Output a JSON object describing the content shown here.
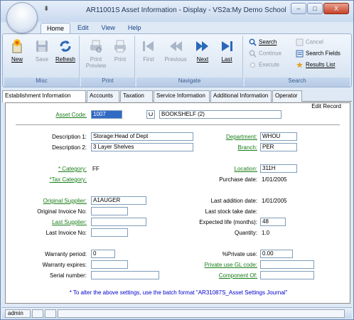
{
  "window": {
    "title": "AR11001S Asset Information - Display - VS2a:My Demo School",
    "qat_symbol": "⇟",
    "minimize": "–",
    "maximize": "□",
    "close": "X"
  },
  "ribbon_tabs": [
    {
      "label": "Home",
      "active": true
    },
    {
      "label": "Edit",
      "active": false
    },
    {
      "label": "View",
      "active": false
    },
    {
      "label": "Help",
      "active": false
    }
  ],
  "ribbon": {
    "misc": {
      "caption": "Misc",
      "new": "New",
      "save": "Save",
      "refresh": "Refresh"
    },
    "print": {
      "caption": "Print",
      "print_preview": "Print Preview",
      "print": "Print"
    },
    "navigate": {
      "caption": "Navigate",
      "first": "First",
      "previous": "Previous",
      "next": "Next",
      "last": "Last"
    },
    "search": {
      "caption": "Search",
      "search": "Search",
      "continue": "Continue",
      "execute": "Execute",
      "cancel": "Cancel",
      "search_fields": "Search Fields",
      "results_list": "Results List"
    }
  },
  "form_tabs": [
    {
      "label": "Establishment Information",
      "active": true
    },
    {
      "label": "Accounts",
      "active": false
    },
    {
      "label": "Taxation",
      "active": false
    },
    {
      "label": "Service Information",
      "active": false
    },
    {
      "label": "Additional Information",
      "active": false
    },
    {
      "label": "Operator",
      "active": false
    }
  ],
  "form": {
    "mode": "Edit Record",
    "asset_code_label": "Asset Code:",
    "asset_code": "1007",
    "asset_code_dropdown": "⮋",
    "asset_name": "BOOKSHELF (2)",
    "description1_label": "Description 1:",
    "description1": "Storage:Head of Dept",
    "description2_label": "Description 2:",
    "description2": "3 Layer Shelves",
    "department_label": "Department:",
    "department": "WHOU",
    "branch_label": "Branch:",
    "branch": "PER",
    "category_label": "* Category:",
    "category": "FF",
    "tax_category_label": "*Tax Category:",
    "location_label": "Location:",
    "location": "311H",
    "purchase_date_label": "Purchase date:",
    "purchase_date": "1/01/2005",
    "original_supplier_label": "Original Supplier:",
    "original_supplier": "A1AUGER",
    "original_invoice_label": "Original Invoice No:",
    "original_invoice": "",
    "last_supplier_label": "Last Supplier:",
    "last_supplier": "",
    "last_invoice_label": "Last Invoice No:",
    "last_invoice": "",
    "last_addition_label": "Last addition date:",
    "last_addition": "1/01/2005",
    "last_stocktake_label": "Last stock take date:",
    "last_stocktake": "",
    "expected_life_label": "Expected life (months):",
    "expected_life": "48",
    "quantity_label": "Quantity:",
    "quantity": "1.0",
    "warranty_period_label": "Warranty period:",
    "warranty_period": "0",
    "warranty_expires_label": "Warranty expires:",
    "warranty_expires": "",
    "serial_label": "Serial number:",
    "serial": "",
    "private_use_label": "%Private use:",
    "private_use": "0.00",
    "private_gl_label": "Private use GL code:",
    "private_gl": "",
    "component_of_label": "Component Of:",
    "component_of": "",
    "note": "* To alter the above settings, use the batch format \"AR31087S_Asset Settings Journal\""
  },
  "status": {
    "user": "admin"
  }
}
